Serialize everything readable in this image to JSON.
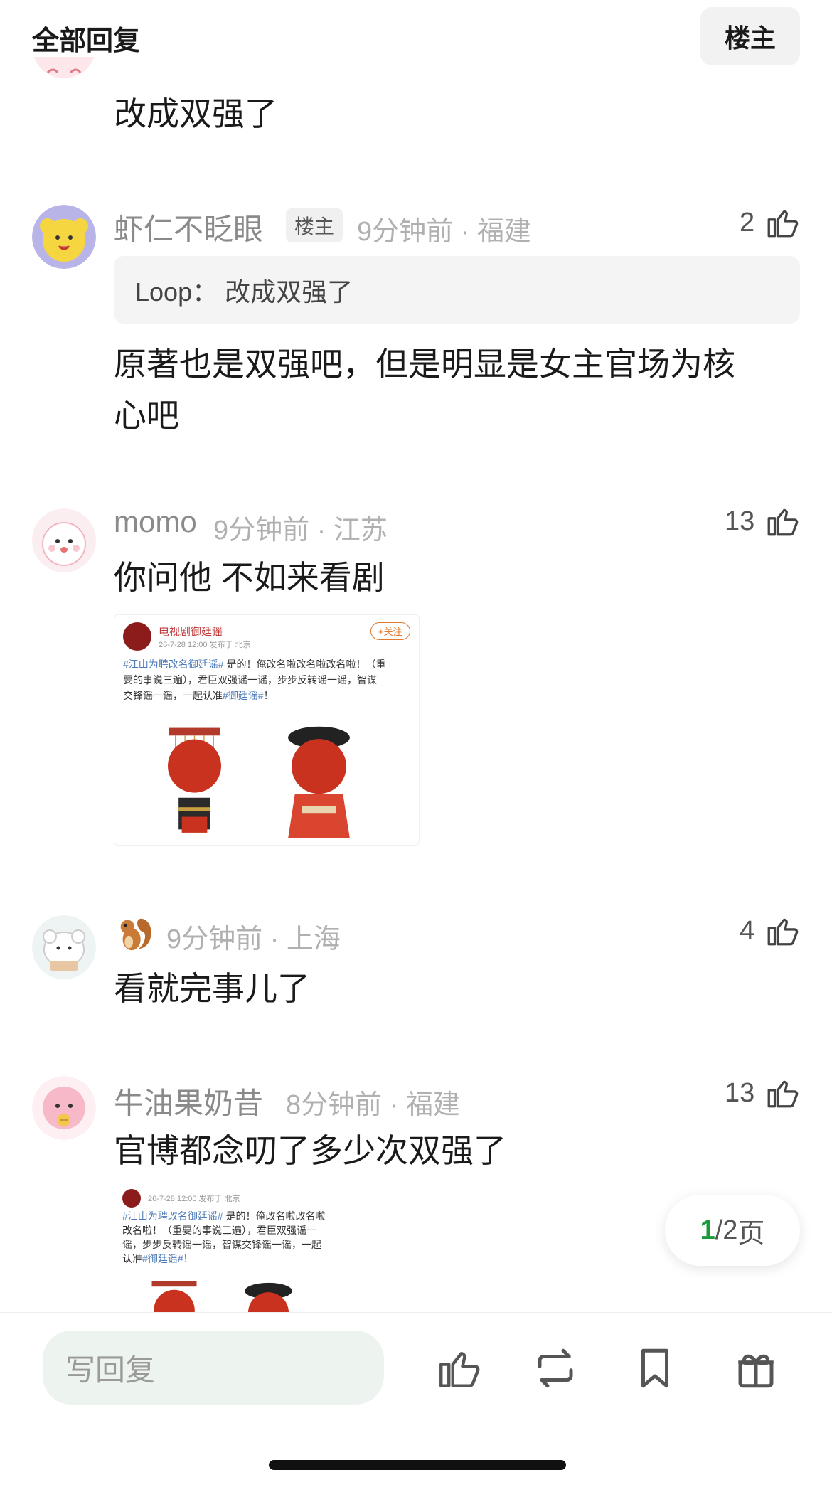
{
  "header": {
    "title": "全部回复",
    "op_button": "楼主"
  },
  "comments": [
    {
      "text": "改成双强了"
    },
    {
      "name": "虾仁不眨眼",
      "tag": "楼主",
      "meta": "9分钟前 · 福建",
      "likes": "2",
      "quote": "Loop： 改成双强了",
      "text_line1": "原著也是双强吧，但是明显是女主官场为核",
      "text_line2": "心吧"
    },
    {
      "name": "momo",
      "meta": "9分钟前 · 江苏",
      "likes": "13",
      "text": "你问他 不如来看剧",
      "image": {
        "account": "电视剧御廷谣",
        "date": "26-7-28 12:00  发布于 北京",
        "follow": "+关注",
        "line1_hl": "#江山为聘改名御廷谣#",
        "line1": " 是的！俺改名啦改名啦改名啦！（重",
        "line2": "要的事说三遍），君臣双强谣一谣，步步反转谣一谣，智谋",
        "line3_a": "交锋谣一谣，一起认准",
        "line3_hl": "#御廷谣#",
        "line3_b": "！"
      }
    },
    {
      "name_emoji": "🐿️",
      "meta": "9分钟前 · 上海",
      "likes": "4",
      "text": "看就完事儿了"
    },
    {
      "name": "牛油果奶昔",
      "meta": "8分钟前 · 福建",
      "likes": "13",
      "text": "官博都念叨了多少次双强了",
      "image": {
        "date": "26-7-28 12:00  发布于 北京",
        "line1_hl": "#江山为聘改名御廷谣#",
        "line1": " 是的！俺改名啦改名啦",
        "line2": "改名啦！（重要的事说三遍），君臣双强谣一",
        "line3": "谣，步步反转谣一谣，智谋交锋谣一谣，一起",
        "line4_a": "认准",
        "line4_hl": "#御廷谣#",
        "line4_b": "！"
      }
    }
  ],
  "pagination": {
    "current": "1",
    "total": "/2",
    "suffix": " 页"
  },
  "bottom": {
    "reply_placeholder": "写回复"
  },
  "colors": {
    "accent_green": "#1a9a3a",
    "link_blue": "#4d7ab8",
    "seal_red": "#c8321e"
  },
  "icons": [
    "thumbs-up-icon",
    "repost-icon",
    "bookmark-icon",
    "gift-icon"
  ]
}
